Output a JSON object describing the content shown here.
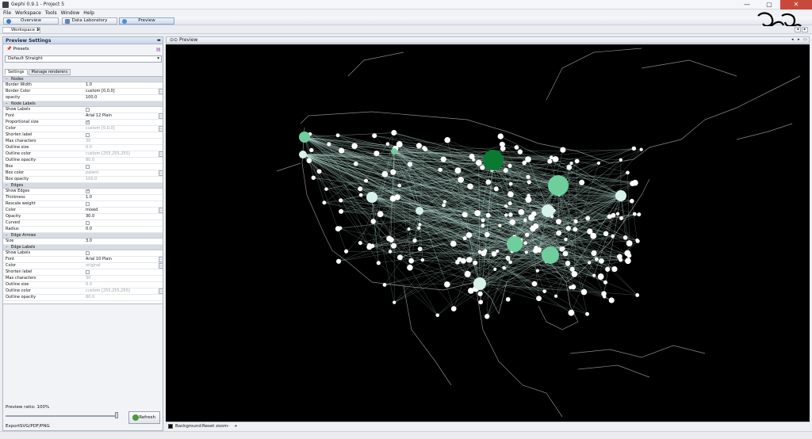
{
  "window": {
    "title": "Gephi 0.9.1 - Project 5",
    "minimize": "—",
    "maximize": "▢",
    "close": "✕"
  },
  "menu": [
    "File",
    "Workspace",
    "Tools",
    "Window",
    "Help"
  ],
  "workbar": {
    "tabs": [
      {
        "label": "Overview",
        "icon_color": "#3b78c6",
        "active": false
      },
      {
        "label": "Data Laboratory",
        "icon_color": "#5f87b5",
        "active": false
      },
      {
        "label": "Preview",
        "icon_color": "#4d8fd6",
        "active": true
      }
    ]
  },
  "workspace_tab": {
    "label": "Workspace 1",
    "close": "✕"
  },
  "nav": {
    "prev": "◂",
    "next": "▸"
  },
  "left_panel": {
    "title": "Preview Settings",
    "presets_label": "Presets",
    "preset_value": "Default Straight",
    "tabs": [
      "Settings",
      "Manage renderers"
    ],
    "sections": [
      {
        "category": "Nodes",
        "rows": [
          {
            "key": "Border Width",
            "value": "1.0"
          },
          {
            "key": "Border Color",
            "value": "custom [0,0,0]",
            "dots": true
          },
          {
            "key": "opacity",
            "value": "100.0"
          }
        ]
      },
      {
        "category": "Node Labels",
        "rows": [
          {
            "key": "Show Labels",
            "checkbox": false
          },
          {
            "key": "Font",
            "value": "Arial 12 Plain",
            "dots": true
          },
          {
            "key": "Proportional size",
            "checkbox": true,
            "disabled": true
          },
          {
            "key": "Color",
            "value": "custom [0,0,0]",
            "disabled": true,
            "dots": true
          },
          {
            "key": "Shorten label",
            "checkbox": false
          },
          {
            "key": "Max characters",
            "value": "30",
            "disabled": true
          },
          {
            "key": "Outline size",
            "value": "0.0",
            "disabled": true
          },
          {
            "key": "Outline color",
            "value": "custom [255,255,255]",
            "disabled": true,
            "dots": true
          },
          {
            "key": "Outline opacity",
            "value": "80.0",
            "disabled": true
          },
          {
            "key": "Box",
            "checkbox": false
          },
          {
            "key": "Box color",
            "value": "parent",
            "disabled": true,
            "dots": true
          },
          {
            "key": "Box opacity",
            "value": "100.0",
            "disabled": true
          }
        ]
      },
      {
        "category": "Edges",
        "rows": [
          {
            "key": "Show Edges",
            "checkbox": true
          },
          {
            "key": "Thickness",
            "value": "1.0"
          },
          {
            "key": "Rescale weight",
            "checkbox": false
          },
          {
            "key": "Color",
            "value": "mixed",
            "dots": true
          },
          {
            "key": "Opacity",
            "value": "30.0"
          },
          {
            "key": "Curved",
            "checkbox": false
          },
          {
            "key": "Radius",
            "value": "0.0"
          }
        ]
      },
      {
        "category": "Edge Arrows",
        "rows": [
          {
            "key": "Size",
            "value": "3.0"
          }
        ]
      },
      {
        "category": "Edge Labels",
        "rows": [
          {
            "key": "Show Labels",
            "checkbox": false
          },
          {
            "key": "Font",
            "value": "Arial 10 Plain",
            "dots": true
          },
          {
            "key": "Color",
            "value": "original",
            "disabled": true,
            "dots": true
          },
          {
            "key": "Shorten label",
            "checkbox": false,
            "disabled": true
          },
          {
            "key": "Max characters",
            "value": "30",
            "disabled": true
          },
          {
            "key": "Outline size",
            "value": "0.0",
            "disabled": true
          },
          {
            "key": "Outline color",
            "value": "custom [255,255,255]",
            "disabled": true,
            "dots": true
          },
          {
            "key": "Outline opacity",
            "value": "80.0",
            "disabled": true
          }
        ]
      }
    ],
    "ratio_label": "Preview ratio: 100%",
    "ratio_percent": 100,
    "refresh_label": "Refresh",
    "export_label": "Export:",
    "export_formats": "SVG/PDF/PNG"
  },
  "preview": {
    "tab_label": "Preview",
    "background_label": "Background",
    "reset_zoom_label": "Reset zoom",
    "zoom_out": "-",
    "zoom_in": "+",
    "colors": {
      "background": "#000000",
      "edge": "#bfe7dc",
      "node_light": "#d6f2ea",
      "node_mid": "#6fcf9c",
      "node_dark": "#0a7a32",
      "map_border": "#8a8a8a"
    }
  }
}
